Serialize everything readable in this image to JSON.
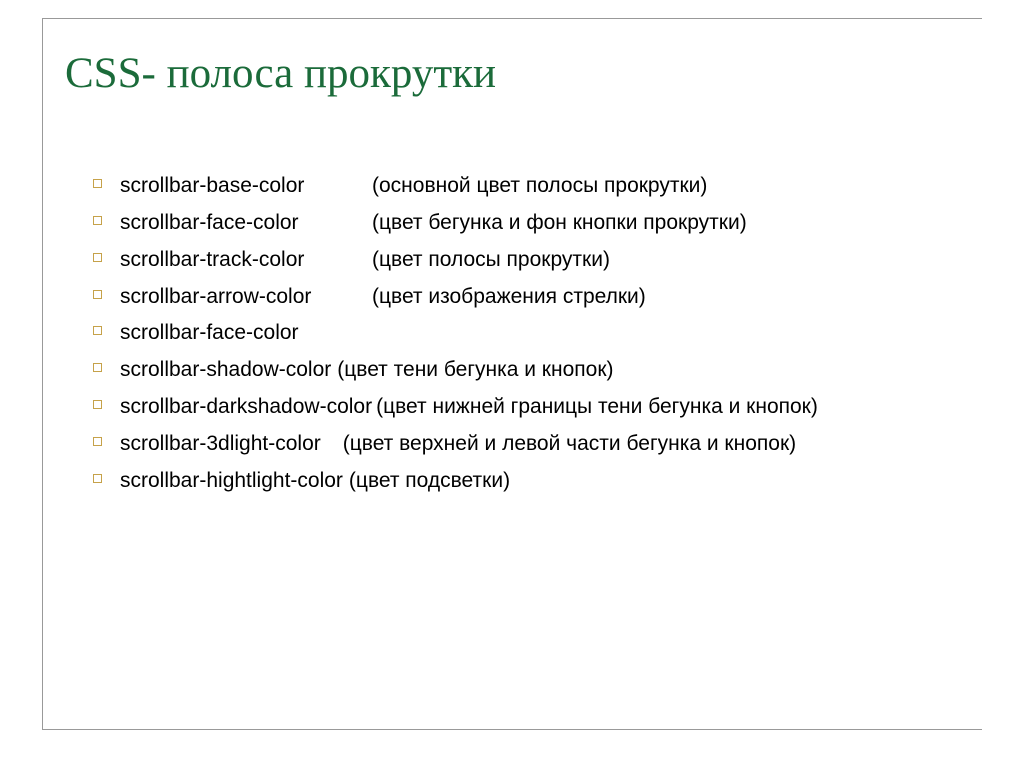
{
  "title": "CSS- полоса прокрутки",
  "items": [
    {
      "prop": "scrollbar-base-color",
      "desc": "(основной цвет полосы прокрутки)"
    },
    {
      "prop": "scrollbar-face-color",
      "desc": "(цвет бегунка и фон кнопки прокрутки)"
    },
    {
      "prop": "scrollbar-track-color",
      "desc": "(цвет полосы прокрутки)"
    },
    {
      "prop": "scrollbar-arrow-color",
      "desc": "(цвет изображения стрелки)"
    },
    {
      "prop": "scrollbar-face-color",
      "desc": ""
    },
    {
      "prop": "scrollbar-shadow-color",
      "desc": "(цвет тени бегунка и кнопок)"
    },
    {
      "prop": "scrollbar-darkshadow-color",
      "desc": "(цвет нижней границы тени бегунка и кнопок)"
    },
    {
      "prop": "scrollbar-3dlight-color",
      "desc": "(цвет верхней и левой части бегунка и кнопок)"
    },
    {
      "prop": "scrollbar-hightlight-color",
      "desc": "(цвет подсветки)"
    }
  ]
}
